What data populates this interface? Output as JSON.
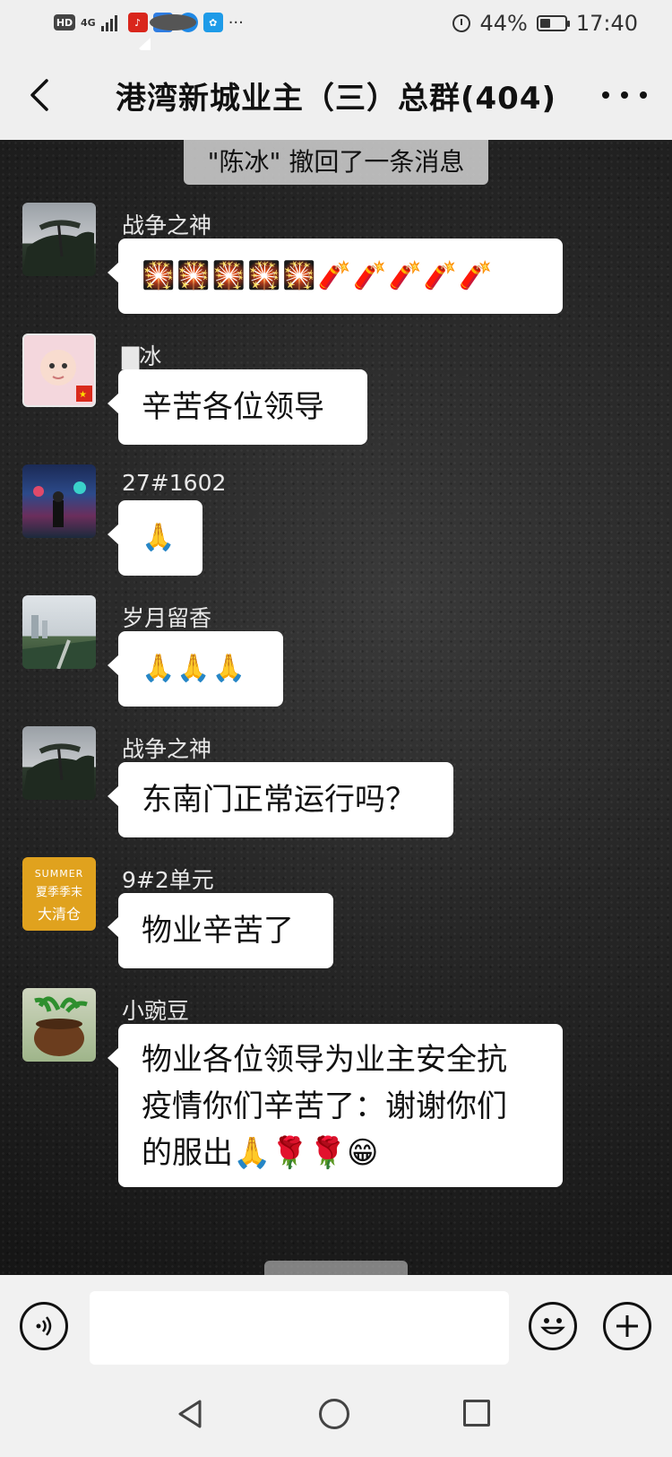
{
  "status_bar": {
    "hd": "HD",
    "network": "4G",
    "battery": "44%",
    "battery_level": 0.44,
    "time": "17:40",
    "more": "···"
  },
  "header": {
    "title": "港湾新城业主（三）总群(404)"
  },
  "system_message": "\"陈冰\" 撤回了一条消息",
  "messages": [
    {
      "sender": "战争之神",
      "text": "🎇🎇🎇🎇🎇🧨🧨🧨🧨🧨"
    },
    {
      "sender": "▇冰",
      "text": "辛苦各位领导"
    },
    {
      "sender": "27#1602",
      "text": "🙏"
    },
    {
      "sender": "岁月留香",
      "text": "🙏🙏🙏"
    },
    {
      "sender": "战争之神",
      "text": "东南门正常运行吗？"
    },
    {
      "sender": "9#2单元",
      "text": "物业辛苦了"
    },
    {
      "sender": "小豌豆",
      "text_lines": [
        "物业各位领导为业主安全抗",
        "疫情你们辛苦了：谢谢你们",
        "的服出🙏🌹🌹😁"
      ]
    }
  ],
  "avatars": {
    "summer_line1": "SUMMER",
    "summer_line2": "夏季季末",
    "summer_line3": "大清仓"
  }
}
